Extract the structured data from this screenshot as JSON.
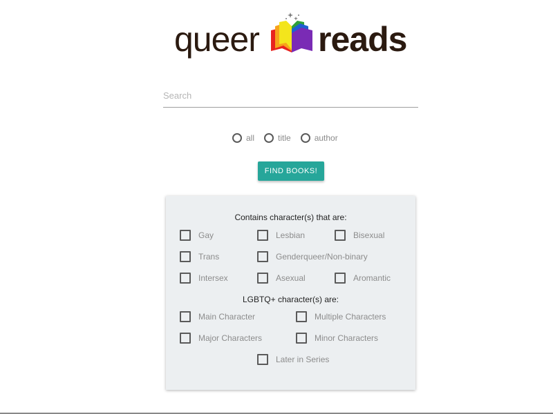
{
  "logo": {
    "word1": "queer",
    "word2": "reads",
    "book_colors": [
      "#e8231f",
      "#f7a21b",
      "#f3e51c",
      "#2e9f3a",
      "#1f5fd0",
      "#7a2bb5"
    ]
  },
  "search": {
    "placeholder": "Search",
    "value": ""
  },
  "search_by": {
    "options": [
      "all",
      "title",
      "author"
    ],
    "selected": null
  },
  "find_button": {
    "label": "FIND BOOKS!"
  },
  "filters": {
    "identity_heading": "Contains character(s) that are:",
    "identities": [
      "Gay",
      "Lesbian",
      "Bisexual",
      "Trans",
      "Genderqueer/Non-binary",
      "Intersex",
      "Asexual",
      "Aromantic"
    ],
    "role_heading": "LGBTQ+ character(s) are:",
    "roles": [
      "Main Character",
      "Multiple Characters",
      "Major Characters",
      "Minor Characters",
      "Later in Series"
    ]
  },
  "colors": {
    "accent": "#26a69a",
    "card_bg": "#eceff1",
    "logo_text": "#2b1a10"
  }
}
